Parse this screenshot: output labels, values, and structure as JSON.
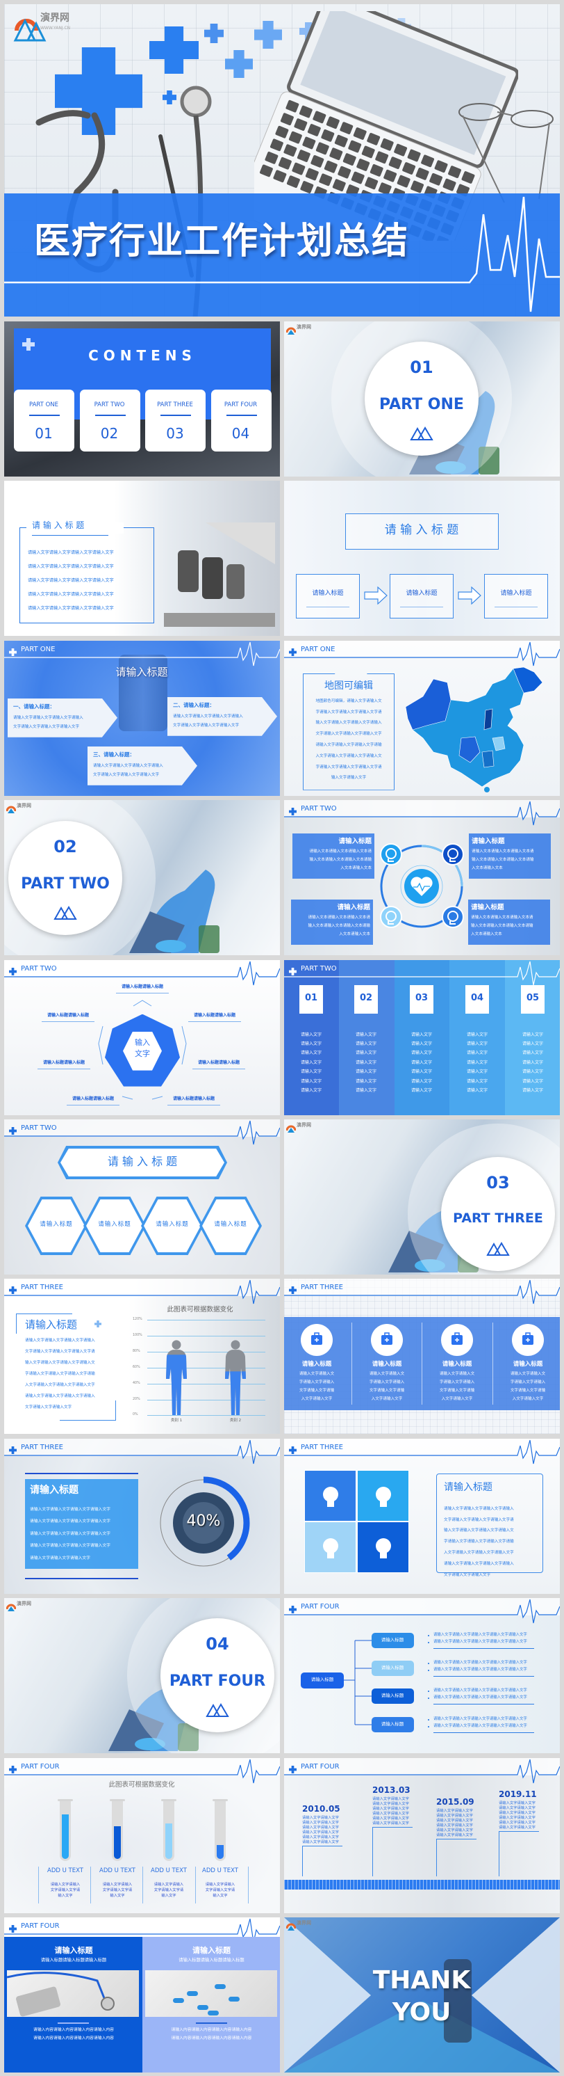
{
  "colors": {
    "primary": "#2b7bf0",
    "dark": "#0a5ad6",
    "light": "#8fd3fb",
    "gray_bg": "#d9d9d9"
  },
  "hero": {
    "title": "医疗行业工作计划总结",
    "logo_text": "演界网",
    "logo_sub": "WWW.YANJ.CN"
  },
  "contents": {
    "title": "CONTENS",
    "items": [
      {
        "label": "PART ONE",
        "num": "01"
      },
      {
        "label": "PART TWO",
        "num": "02"
      },
      {
        "label": "PART THREE",
        "num": "03"
      },
      {
        "label": "PART FOUR",
        "num": "04"
      }
    ]
  },
  "part_one_cover": {
    "num": "01",
    "title": "PART ONE"
  },
  "part_one_text": {
    "header": "PART ONE",
    "title": "请 输 入 标 题",
    "lines": [
      "请输入文字请输入文字请输入文字请输入文字",
      "请输入文字请输入文字请输入文字请输入文字",
      "请输入文字请输入文字请输入文字请输入文字",
      "请输入文字请输入文字请输入文字请输入文字",
      "请输入文字请输入文字请输入文字请输入文字"
    ]
  },
  "part_one_flow": {
    "header": "PART ONE",
    "title": "请 输 入 标 题",
    "steps": [
      "请输入标题",
      "请输入标题",
      "请输入标题"
    ]
  },
  "part_one_arrows": {
    "header": "PART ONE",
    "title": "请输入标题",
    "items": [
      {
        "heading": "一、请输入标题：",
        "lines": [
          "请输入文字请输入文字请输入文字请输入",
          "文字请输入文字请输入文字请输入文字"
        ]
      },
      {
        "heading": "二、请输入标题：",
        "lines": [
          "请输入文字请输入文字请输入文字请输入",
          "文字请输入文字请输入文字请输入文字"
        ]
      },
      {
        "heading": "三、请输入标题：",
        "lines": [
          "请输入文字请输入文字请输入文字请输入",
          "文字请输入文字请输入文字请输入文字"
        ]
      }
    ]
  },
  "part_one_map": {
    "header": "PART ONE",
    "title": "地图可编辑",
    "lines": [
      "地图颜色可编辑，请输入文字请输入文",
      "字请输入文字请输入文字请输入文字请",
      "输入文字请输入文字请输入文字请输入",
      "文字请输入文字请输入文字请输入文字",
      "请输入文字请输入文字请输入文字请输",
      "入文字请输入文字请输入文字请输入文",
      "字请输入文字请输入文字请输入文字请",
      "输入文字请输入文字"
    ]
  },
  "part_two_cover": {
    "num": "02",
    "title": "PART TWO"
  },
  "part_two_ring": {
    "header": "PART TWO",
    "center_icon": "heart-pulse-icon",
    "items": [
      {
        "title": "请输入标题",
        "icon": "brain-icon",
        "lines": [
          "请输入文本请输入文本请输入文本请",
          "输入文本请输入文本请输入文本请输",
          "入文本请输入文本"
        ]
      },
      {
        "title": "请输入标题",
        "icon": "head-brain-icon",
        "lines": [
          "请输入文本请输入文本请输入文本请",
          "输入文本请输入文本请输入文本请输",
          "入文本请输入文本"
        ]
      },
      {
        "title": "请输入标题",
        "icon": "dropper-icon",
        "lines": [
          "请输入文本请输入文本请输入文本请",
          "输入文本请输入文本请输入文本请输",
          "入文本请输入文本"
        ]
      },
      {
        "title": "请输入标题",
        "icon": "iv-bag-icon",
        "lines": [
          "请输入文本请输入文本请输入文本请",
          "输入文本请输入文本请输入文本请输",
          "入文本请输入文本"
        ]
      }
    ]
  },
  "part_two_hex": {
    "header": "PART TWO",
    "center": [
      "输入",
      "文字"
    ],
    "labels": [
      "请输入标题请输入标题",
      "请输入标题请输入标题",
      "请输入标题请输入标题",
      "请输入标题请输入标题",
      "请输入标题请输入标题",
      "请输入标题请输入标题",
      "请输入标题请输入标题"
    ]
  },
  "part_two_columns": {
    "header": "PART TWO",
    "columns": [
      {
        "num": "01",
        "lines": [
          "请输入文字",
          "请输入文字",
          "请输入文字",
          "请输入文字",
          "请输入文字",
          "请输入文字",
          "请输入文字"
        ]
      },
      {
        "num": "02",
        "lines": [
          "请输入文字",
          "请输入文字",
          "请输入文字",
          "请输入文字",
          "请输入文字",
          "请输入文字",
          "请输入文字"
        ]
      },
      {
        "num": "03",
        "lines": [
          "请输入文字",
          "请输入文字",
          "请输入文字",
          "请输入文字",
          "请输入文字",
          "请输入文字",
          "请输入文字"
        ]
      },
      {
        "num": "04",
        "lines": [
          "请输入文字",
          "请输入文字",
          "请输入文字",
          "请输入文字",
          "请输入文字",
          "请输入文字",
          "请输入文字"
        ]
      },
      {
        "num": "05",
        "lines": [
          "请输入文字",
          "请输入文字",
          "请输入文字",
          "请输入文字",
          "请输入文字",
          "请输入文字",
          "请输入文字"
        ]
      }
    ]
  },
  "part_two_hexrow": {
    "header": "PART TWO",
    "title": "请 输 入 标 题",
    "items": [
      "请输入标题",
      "请输入标题",
      "请输入标题",
      "请输入标题"
    ]
  },
  "part_three_cover": {
    "num": "03",
    "title": "PART THREE"
  },
  "part_three_chart": {
    "header": "PART THREE",
    "title": "请输入标题",
    "lines": [
      "请输入文字请输入文字请输入文字请输入",
      "文字请输入文字请输入文字请输入文字请",
      "输入文字请输入文字请输入文字请输入文",
      "字请输入文字请输入文字请输入文字请输",
      "入文字请输入文字请输入文字请输入文字",
      "请输入文字请输入文字请输入文字请输入",
      "文字请输入文字请输入文字"
    ]
  },
  "part_three_icons": {
    "header": "PART THREE",
    "items": [
      {
        "title": "请输入标题",
        "icon": "medical-kit-icon",
        "lines": [
          "请输入文字请输入文",
          "字请输入文字请输入",
          "文字请输入文字请输",
          "入文字请输入文字"
        ]
      },
      {
        "title": "请输入标题",
        "icon": "medicine-bottle-icon",
        "lines": [
          "请输入文字请输入文",
          "字请输入文字请输入",
          "文字请输入文字请输",
          "入文字请输入文字"
        ]
      },
      {
        "title": "请输入标题",
        "icon": "ambulance-icon",
        "lines": [
          "请输入文字请输入文",
          "字请输入文字请输入",
          "文字请输入文字请输",
          "入文字请输入文字"
        ]
      },
      {
        "title": "请输入标题",
        "icon": "stethoscope-icon",
        "lines": [
          "请输入文字请输入文",
          "字请输入文字请输入",
          "文字请输入文字请输",
          "入文字请输入文字"
        ]
      }
    ]
  },
  "part_three_percent": {
    "header": "PART THREE",
    "title": "请输入标题",
    "percent": 40,
    "percent_label": "40%",
    "lines": [
      "请输入文字请输入文字请输入文字请输入文字",
      "请输入文字请输入文字请输入文字请输入文字",
      "请输入文字请输入文字请输入文字请输入文字",
      "请输入文字请输入文字请输入文字请输入文字",
      "请输入文字请输入文字请输入文字"
    ]
  },
  "part_three_puzzle": {
    "header": "PART THREE",
    "title": "请输入标题",
    "icons": [
      "head-brain-icon",
      "brain-icon",
      "medicine-bottle-icon",
      "iv-bag-icon"
    ],
    "lines": [
      "请输入文字请输入文字请输入文字请输入",
      "文字请输入文字请输入文字请输入文字请",
      "输入文字请输入文字请输入文字请输入文",
      "字请输入文字请输入文字请输入文字请输",
      "入文字请输入文字请输入文字请输入文字",
      "请输入文字请输入文字请输入文字请输入",
      "文字请输入文字请输入文字"
    ]
  },
  "part_four_cover": {
    "num": "04",
    "title": "PART FOUR"
  },
  "part_four_tree": {
    "header": "PART FOUR",
    "root": "请输入标题",
    "branches": [
      {
        "label": "请输入标题",
        "lines": [
          "请输入文字请输入文字请输入文字请输入文字请输入文字",
          "请输入文字请输入文字请输入文字请输入文字请输入文字"
        ]
      },
      {
        "label": "请输入标题",
        "lines": [
          "请输入文字请输入文字请输入文字请输入文字请输入文字",
          "请输入文字请输入文字请输入文字请输入文字请输入文字"
        ]
      },
      {
        "label": "请输入标题",
        "lines": [
          "请输入文字请输入文字请输入文字请输入文字请输入文字",
          "请输入文字请输入文字请输入文字请输入文字请输入文字"
        ]
      },
      {
        "label": "请输入标题",
        "lines": [
          "请输入文字请输入文字请输入文字请输入文字请输入文字",
          "请输入文字请输入文字请输入文字请输入文字请输入文字"
        ]
      }
    ]
  },
  "part_four_tubes": {
    "header": "PART FOUR",
    "items": [
      {
        "label": "ADD U TEXT",
        "lines": [
          "请输入文字请输入",
          "文字请输入文字请",
          "输入文字"
        ]
      },
      {
        "label": "ADD U TEXT",
        "lines": [
          "请输入文字请输入",
          "文字请输入文字请",
          "输入文字"
        ]
      },
      {
        "label": "ADD U TEXT",
        "lines": [
          "请输入文字请输入",
          "文字请输入文字请",
          "输入文字"
        ]
      },
      {
        "label": "ADD U TEXT",
        "lines": [
          "请输入文字请输入",
          "文字请输入文字请",
          "输入文字"
        ]
      }
    ]
  },
  "part_four_timeline": {
    "header": "PART FOUR",
    "events": [
      {
        "date": "2010.05",
        "lines": [
          "请输入文字请输入文字",
          "请输入文字请输入文字",
          "请输入文字请输入文字",
          "请输入文字请输入文字",
          "请输入文字请输入文字",
          "请输入文字请输入文字"
        ]
      },
      {
        "date": "2013.03",
        "lines": [
          "请输入文字请输入文字",
          "请输入文字请输入文字",
          "请输入文字请输入文字",
          "请输入文字请输入文字",
          "请输入文字请输入文字",
          "请输入文字请输入文字"
        ]
      },
      {
        "date": "2015.09",
        "lines": [
          "请输入文字请输入文字",
          "请输入文字请输入文字",
          "请输入文字请输入文字",
          "请输入文字请输入文字",
          "请输入文字请输入文字",
          "请输入文字请输入文字"
        ]
      },
      {
        "date": "2019.11",
        "lines": [
          "请输入文字请输入文字",
          "请输入文字请输入文字",
          "请输入文字请输入文字",
          "请输入文字请输入文字",
          "请输入文字请输入文字",
          "请输入文字请输入文字"
        ]
      }
    ]
  },
  "part_four_images": {
    "header": "PART FOUR",
    "panels": [
      {
        "title": "请输入标题",
        "subtitle": "请输入标题请输入标题请输入标题",
        "lines": [
          "请输入内容请输入内容请输入内容请输入内容",
          "请输入内容请输入内容请输入内容请输入内容"
        ]
      },
      {
        "title": "请输入标题",
        "subtitle": "请输入标题请输入标题请输入标题",
        "lines": [
          "请输入内容请输入内容请输入内容请输入内容",
          "请输入内容请输入内容请输入内容请输入内容"
        ]
      }
    ]
  },
  "thanks": {
    "line1": "THANK",
    "line2": "YOU"
  },
  "chart_data": [
    {
      "type": "bar",
      "title": "此图表可根据数据变化",
      "categories": [
        "类别 1",
        "类别 2"
      ],
      "values": [
        76,
        55
      ],
      "yticks": [
        "0%",
        "20%",
        "40%",
        "60%",
        "80%",
        "100%",
        "120%"
      ],
      "ylim": [
        0,
        120
      ],
      "grid": true,
      "unit": "%"
    },
    {
      "type": "bar",
      "title": "此图表可根据数据变化",
      "categories": [
        "ADD U TEXT",
        "ADD U TEXT",
        "ADD U TEXT",
        "ADD U TEXT"
      ],
      "values": [
        80,
        58,
        63,
        25
      ],
      "ylim": [
        0,
        100
      ]
    }
  ]
}
